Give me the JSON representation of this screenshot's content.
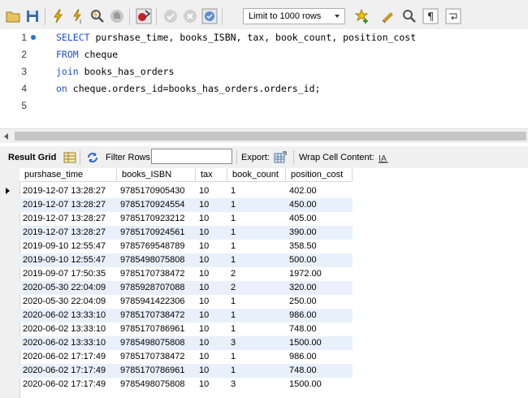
{
  "toolbar": {
    "limit_label": "Limit to 1000 rows",
    "icons": [
      "open-file-icon",
      "save-icon",
      "execute-icon",
      "execute-current-icon",
      "explain-icon",
      "stop-icon",
      "toggle-continue-on-error-icon",
      "commit-icon",
      "rollback-icon",
      "autocommit-icon",
      "add-snippet-icon",
      "beautify-icon",
      "find-icon",
      "invisible-chars-icon",
      "word-wrap-icon"
    ]
  },
  "editor": {
    "lines": [
      {
        "num": "1",
        "parts": [
          {
            "t": "SELECT",
            "kw": true
          },
          {
            "t": " purshase_time, books_ISBN, tax, book_count, position_cost",
            "kw": false
          }
        ]
      },
      {
        "num": "2",
        "parts": [
          {
            "t": "FROM",
            "kw": true
          },
          {
            "t": " cheque",
            "kw": false
          }
        ]
      },
      {
        "num": "3",
        "parts": [
          {
            "t": "join",
            "kw": true
          },
          {
            "t": " books_has_orders",
            "kw": false
          }
        ]
      },
      {
        "num": "4",
        "parts": [
          {
            "t": "on",
            "kw": true
          },
          {
            "t": " cheque.orders_id=books_has_orders.orders_id;",
            "kw": false
          }
        ]
      },
      {
        "num": "5",
        "parts": []
      }
    ]
  },
  "result_bar": {
    "result_grid_label": "Result Grid",
    "filter_rows_label": "Filter Rows:",
    "filter_value": "",
    "export_label": "Export:",
    "wrap_label": "Wrap Cell Content:"
  },
  "grid": {
    "columns": [
      "purshase_time",
      "books_ISBN",
      "tax",
      "book_count",
      "position_cost"
    ],
    "rows": [
      [
        "2019-12-07 13:28:27",
        "9785170905430",
        "10",
        "1",
        "402.00"
      ],
      [
        "2019-12-07 13:28:27",
        "9785170924554",
        "10",
        "1",
        "450.00"
      ],
      [
        "2019-12-07 13:28:27",
        "9785170923212",
        "10",
        "1",
        "405.00"
      ],
      [
        "2019-12-07 13:28:27",
        "9785170924561",
        "10",
        "1",
        "390.00"
      ],
      [
        "2019-09-10 12:55:47",
        "9785769548789",
        "10",
        "1",
        "358.50"
      ],
      [
        "2019-09-10 12:55:47",
        "9785498075808",
        "10",
        "1",
        "500.00"
      ],
      [
        "2019-09-07 17:50:35",
        "9785170738472",
        "10",
        "2",
        "1972.00"
      ],
      [
        "2020-05-30 22:04:09",
        "9785928707088",
        "10",
        "2",
        "320.00"
      ],
      [
        "2020-05-30 22:04:09",
        "9785941422306",
        "10",
        "1",
        "250.00"
      ],
      [
        "2020-06-02 13:33:10",
        "9785170738472",
        "10",
        "1",
        "986.00"
      ],
      [
        "2020-06-02 13:33:10",
        "9785170786961",
        "10",
        "1",
        "748.00"
      ],
      [
        "2020-06-02 13:33:10",
        "9785498075808",
        "10",
        "3",
        "1500.00"
      ],
      [
        "2020-06-02 17:17:49",
        "9785170738472",
        "10",
        "1",
        "986.00"
      ],
      [
        "2020-06-02 17:17:49",
        "9785170786961",
        "10",
        "1",
        "748.00"
      ],
      [
        "2020-06-02 17:17:49",
        "9785498075808",
        "10",
        "3",
        "1500.00"
      ]
    ]
  },
  "colors": {
    "keyword": "#1e4fd6",
    "row_alt": "#e8f1fb",
    "toolbar_bg": "#f0f0f0"
  }
}
